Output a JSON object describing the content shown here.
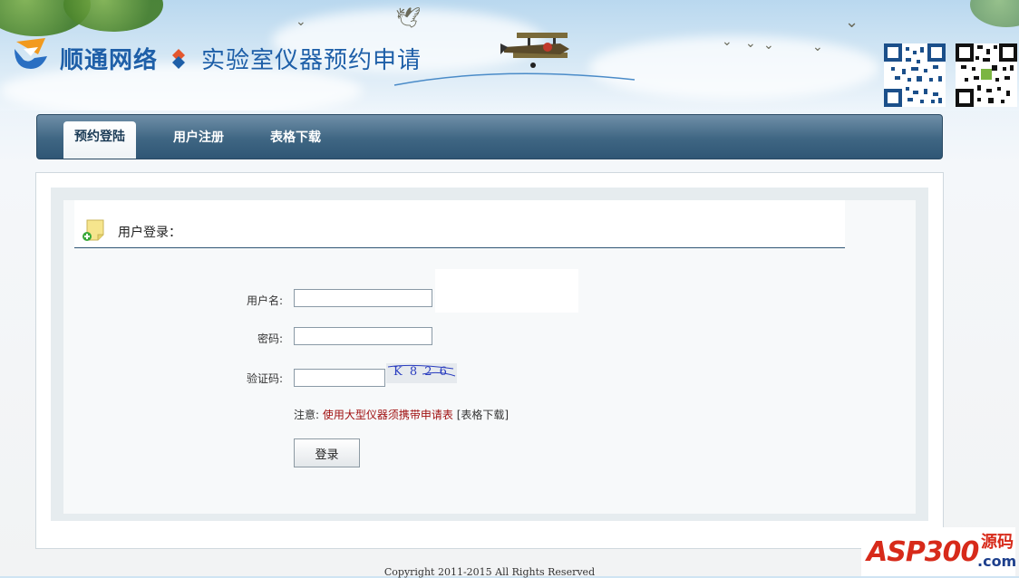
{
  "header": {
    "brand": "顺通网络",
    "subtitle": "实验室仪器预约申请"
  },
  "nav": {
    "tabs": [
      {
        "label": "预约登陆",
        "active": true
      },
      {
        "label": "用户注册",
        "active": false
      },
      {
        "label": "表格下载",
        "active": false
      }
    ]
  },
  "login": {
    "section_title": "用户登录：",
    "username_label": "用户名:",
    "password_label": "密码:",
    "captcha_label": "验证码:",
    "username_value": "",
    "password_value": "",
    "captcha_value": "",
    "captcha_image_text": "K 8 2 6",
    "notice_prefix": "注意:",
    "notice_required": "使用大型仪器须携带申请表",
    "notice_link": "[表格下载]",
    "login_button": "登录"
  },
  "footer": {
    "copyright": "Copyright 2011-2015 All Rights Reserved"
  },
  "watermark": {
    "logo_text": "ASP300",
    "cn_text": "源码",
    "domain_text": ".com"
  },
  "colors": {
    "brand_blue": "#1e5fa8",
    "nav_bar": "#3f6683",
    "notice_red": "#a01010"
  },
  "icons": [
    "logo-icon",
    "diamond-icon",
    "plane-image",
    "bird-icon",
    "qr-code-image",
    "note-add-icon"
  ]
}
